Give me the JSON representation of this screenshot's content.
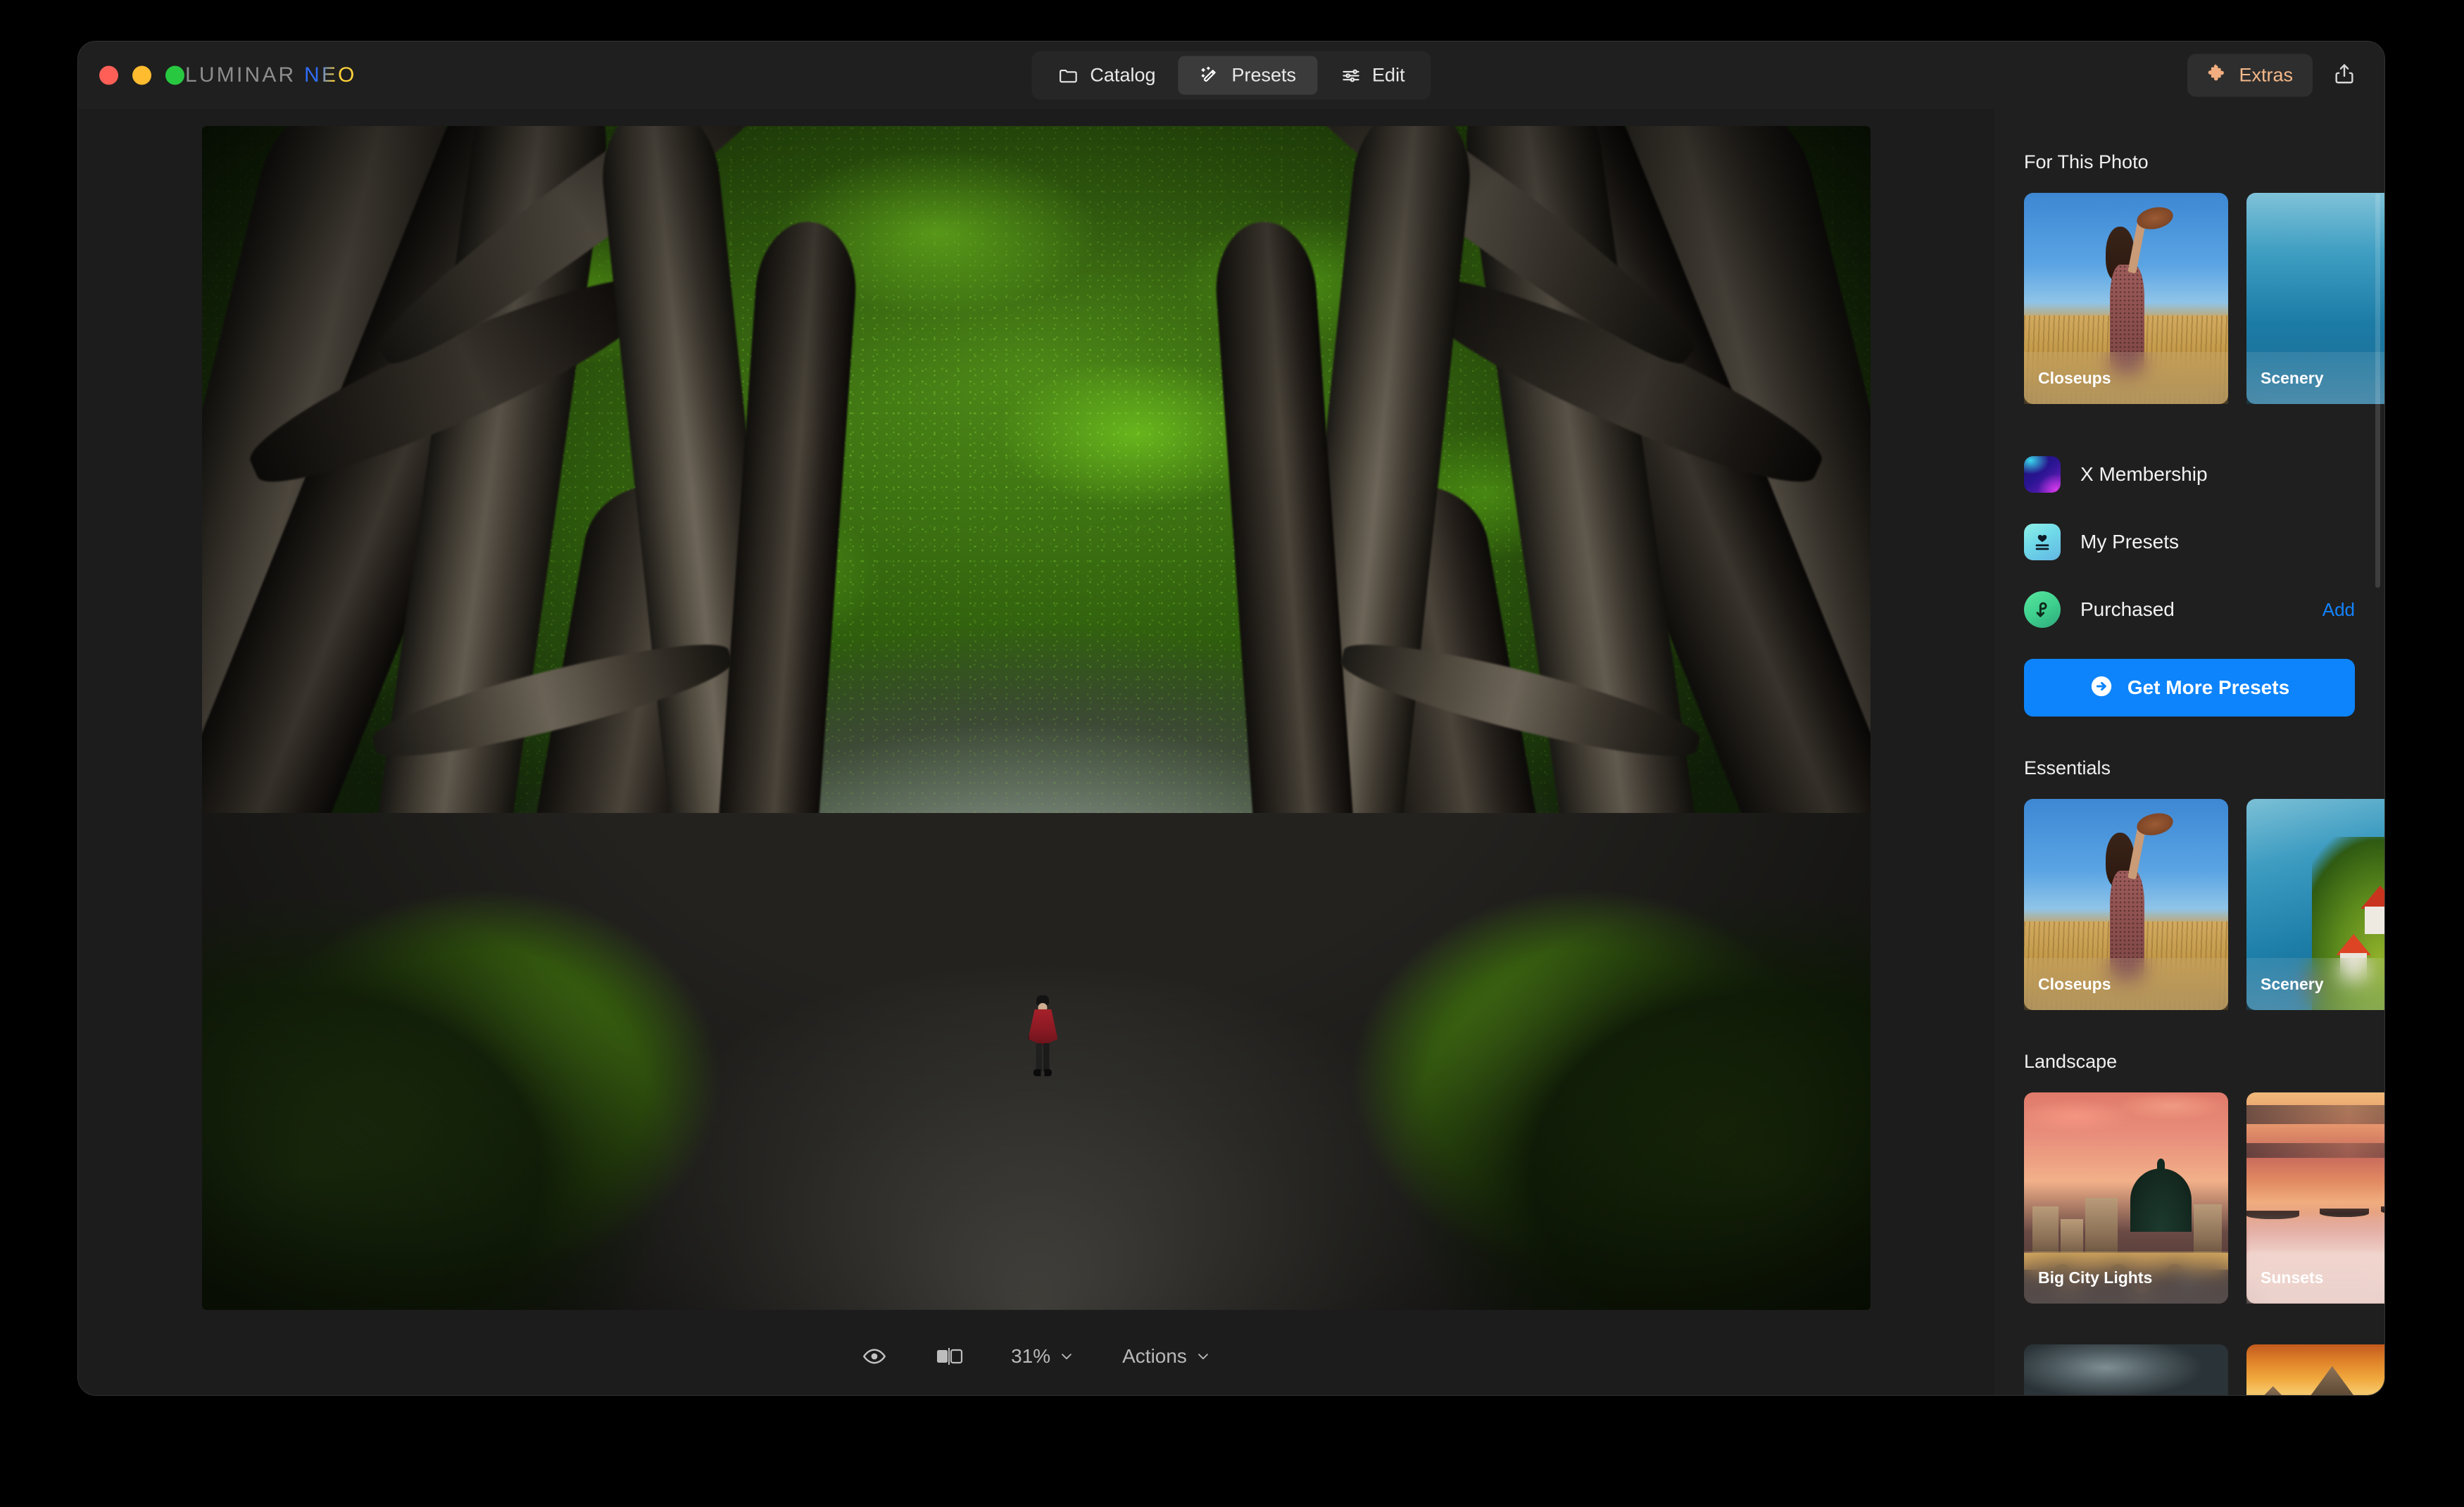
{
  "window": {
    "brand_primary": "LUMINAR",
    "brand_secondary": "NEO",
    "traffic_lights": [
      "close-button",
      "minimize-button",
      "maximize-button"
    ],
    "colors": {
      "close": "#ff5f57",
      "minimize": "#febc2e",
      "maximize": "#28c840",
      "accent_blue": "#0d84fb",
      "link_blue": "#1383ff",
      "extras_orange": "#f5b98a",
      "window_bg": "#1c1c1c",
      "titlebar_bg": "#1f1f1f",
      "sidebar_bg": "#1f1f1f",
      "segment_bg": "#262626",
      "segment_active_bg": "#3b3b3b"
    }
  },
  "nav": {
    "tabs": [
      {
        "label": "Catalog",
        "icon": "folder-icon",
        "active": false
      },
      {
        "label": "Presets",
        "icon": "magic-wand-icon",
        "active": true
      },
      {
        "label": "Edit",
        "icon": "sliders-icon",
        "active": false
      }
    ]
  },
  "titlebar_right": {
    "extras_label": "Extras",
    "extras_icon": "puzzle-piece-icon",
    "share_icon": "share-icon"
  },
  "canvas": {
    "photo_description": "The Dark Hedges beech tree avenue with a person in a red plaid poncho walking on the road"
  },
  "bottom_bar": {
    "items": [
      {
        "name": "preview-toggle",
        "icon": "eye-icon",
        "label": ""
      },
      {
        "name": "compare-toggle",
        "icon": "before-after-icon",
        "label": ""
      },
      {
        "name": "zoom-level",
        "icon": "chevron-down-icon",
        "label": "31%"
      },
      {
        "name": "actions-menu",
        "icon": "chevron-down-icon",
        "label": "Actions"
      }
    ],
    "zoom_value": "31%",
    "actions_label": "Actions"
  },
  "sidebar": {
    "sections": [
      {
        "heading": "For This Photo",
        "layout": "strip",
        "cards": [
          {
            "label": "Closeups",
            "art": "closeups"
          },
          {
            "label": "Scenery",
            "art": "scenery-plain"
          }
        ]
      },
      {
        "heading": "Essentials",
        "layout": "grid",
        "cards": [
          {
            "label": "Closeups",
            "art": "closeups"
          },
          {
            "label": "Scenery",
            "art": "bled"
          }
        ]
      },
      {
        "heading": "Landscape",
        "layout": "grid",
        "cards": [
          {
            "label": "Big City Lights",
            "art": "city"
          },
          {
            "label": "Sunsets",
            "art": "sunset"
          }
        ]
      },
      {
        "heading": "",
        "layout": "grid-clipped",
        "cards": [
          {
            "label": "",
            "art": "storm"
          },
          {
            "label": "",
            "art": "mountain"
          }
        ]
      }
    ],
    "menu_rows": [
      {
        "label": "X Membership",
        "icon": "x-membership-icon",
        "action": ""
      },
      {
        "label": "My Presets",
        "icon": "my-presets-icon",
        "action": ""
      },
      {
        "label": "Purchased",
        "icon": "purchased-icon",
        "action": "Add"
      }
    ],
    "get_more_presets_label": "Get More Presets",
    "get_more_presets_icon": "arrow-right-circle-icon"
  }
}
